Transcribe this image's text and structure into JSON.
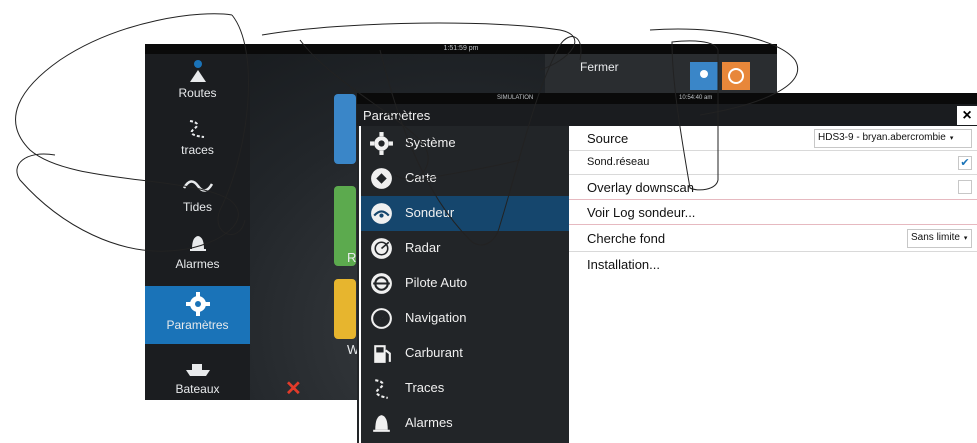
{
  "device": {
    "clock": "1:51:59 pm",
    "rail_items": [
      {
        "label": "Routes",
        "icon": "routes-icon"
      },
      {
        "label": "traces",
        "icon": "traces-icon"
      },
      {
        "label": "Tides",
        "icon": "tides-icon"
      },
      {
        "label": "Alarmes",
        "icon": "bell-icon"
      },
      {
        "label": "Paramètres",
        "icon": "gear-icon",
        "active": true
      },
      {
        "label": "Bateaux",
        "icon": "boat-icon"
      }
    ],
    "fermer": "Fermer",
    "bg_letter_r": "R",
    "bg_letter_w": "W",
    "accent": "#1a73b8"
  },
  "settings": {
    "status_left": "SIMULATION",
    "status_right": "10:54:40 am",
    "title": "Paramètres",
    "close": "×",
    "menu": [
      {
        "label": "Système",
        "icon": "gear-icon"
      },
      {
        "label": "Carte",
        "icon": "chart-icon"
      },
      {
        "label": "Sondeur",
        "icon": "sonar-icon",
        "active": true
      },
      {
        "label": "Radar",
        "icon": "radar-icon"
      },
      {
        "label": "Pilote Auto",
        "icon": "steering-wheel-icon"
      },
      {
        "label": "Navigation",
        "icon": "compass-icon"
      },
      {
        "label": "Carburant",
        "icon": "fuel-icon"
      },
      {
        "label": "Traces",
        "icon": "traces-icon"
      },
      {
        "label": "Alarmes",
        "icon": "bell-icon"
      }
    ],
    "rows": {
      "source_label": "Source",
      "source_value": "HDS3-9 - bryan.abercrombie",
      "sond_reseau_label": "Sond.réseau",
      "sond_reseau_checked": true,
      "overlay_label": "Overlay downscan",
      "overlay_checked": false,
      "voir_log_label": "Voir Log sondeur...",
      "cherche_label": "Cherche fond",
      "cherche_value": "Sans limite",
      "installation_label": "Installation..."
    }
  }
}
